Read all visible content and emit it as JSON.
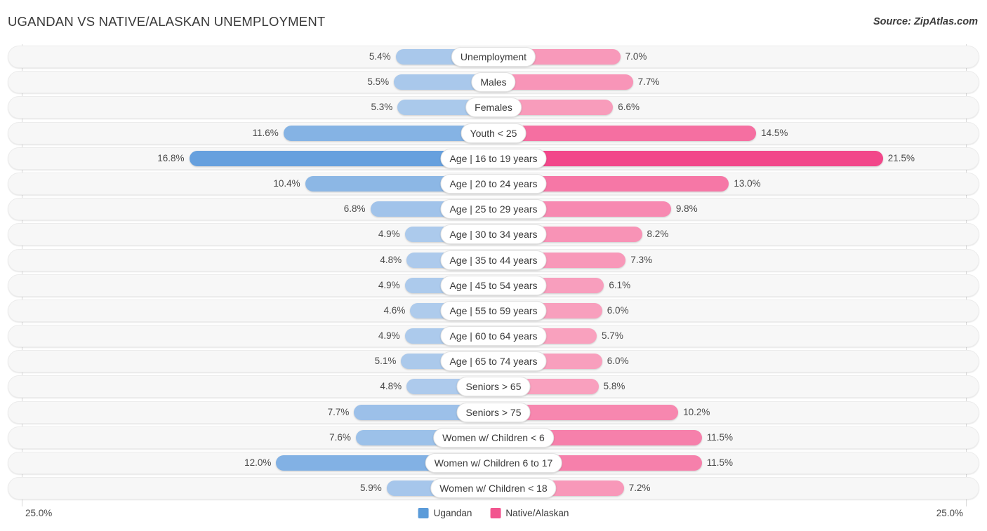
{
  "header": {
    "title": "UGANDAN VS NATIVE/ALASKAN UNEMPLOYMENT",
    "source": "Source: ZipAtlas.com"
  },
  "axis": {
    "min_label": "25.0%",
    "max_label": "25.0%",
    "max_value": 25.0
  },
  "legend": {
    "items": [
      {
        "label": "Ugandan",
        "color": "#5b9bd9"
      },
      {
        "label": "Native/Alaskan",
        "color": "#f2558f"
      }
    ]
  },
  "chart_data": {
    "type": "bar",
    "orientation": "horizontal-diverging",
    "title": "UGANDAN VS NATIVE/ALASKAN UNEMPLOYMENT",
    "xlabel": "",
    "ylabel": "",
    "xlim": [
      25.0,
      25.0
    ],
    "grid": false,
    "legend_position": "bottom-center",
    "categories": [
      "Unemployment",
      "Males",
      "Females",
      "Youth < 25",
      "Age | 16 to 19 years",
      "Age | 20 to 24 years",
      "Age | 25 to 29 years",
      "Age | 30 to 34 years",
      "Age | 35 to 44 years",
      "Age | 45 to 54 years",
      "Age | 55 to 59 years",
      "Age | 60 to 64 years",
      "Age | 65 to 74 years",
      "Seniors > 65",
      "Seniors > 75",
      "Women w/ Children < 6",
      "Women w/ Children 6 to 17",
      "Women w/ Children < 18"
    ],
    "series": [
      {
        "name": "Ugandan",
        "side": "left",
        "color": "#5b9bd9",
        "values": [
          5.4,
          5.5,
          5.3,
          11.6,
          16.8,
          10.4,
          6.8,
          4.9,
          4.8,
          4.9,
          4.6,
          4.9,
          5.1,
          4.8,
          7.7,
          7.6,
          12.0,
          5.9
        ],
        "labels": [
          "5.4%",
          "5.5%",
          "5.3%",
          "11.6%",
          "16.8%",
          "10.4%",
          "6.8%",
          "4.9%",
          "4.8%",
          "4.9%",
          "4.6%",
          "4.9%",
          "5.1%",
          "4.8%",
          "7.7%",
          "7.6%",
          "12.0%",
          "5.9%"
        ]
      },
      {
        "name": "Native/Alaskan",
        "side": "right",
        "color": "#f2558f",
        "values": [
          7.0,
          7.7,
          6.6,
          14.5,
          21.5,
          13.0,
          9.8,
          8.2,
          7.3,
          6.1,
          6.0,
          5.7,
          6.0,
          5.8,
          10.2,
          11.5,
          11.5,
          7.2
        ],
        "labels": [
          "7.0%",
          "7.7%",
          "6.6%",
          "14.5%",
          "21.5%",
          "13.0%",
          "9.8%",
          "8.2%",
          "7.3%",
          "6.1%",
          "6.0%",
          "5.7%",
          "6.0%",
          "5.8%",
          "10.2%",
          "11.5%",
          "11.5%",
          "7.2%"
        ]
      }
    ]
  },
  "rows": [
    {
      "label": "Unemployment",
      "left": "5.4%",
      "right": "7.0%"
    },
    {
      "label": "Males",
      "left": "5.5%",
      "right": "7.7%"
    },
    {
      "label": "Females",
      "left": "5.3%",
      "right": "6.6%"
    },
    {
      "label": "Youth < 25",
      "left": "11.6%",
      "right": "14.5%"
    },
    {
      "label": "Age | 16 to 19 years",
      "left": "16.8%",
      "right": "21.5%"
    },
    {
      "label": "Age | 20 to 24 years",
      "left": "10.4%",
      "right": "13.0%"
    },
    {
      "label": "Age | 25 to 29 years",
      "left": "6.8%",
      "right": "9.8%"
    },
    {
      "label": "Age | 30 to 34 years",
      "left": "4.9%",
      "right": "8.2%"
    },
    {
      "label": "Age | 35 to 44 years",
      "left": "4.8%",
      "right": "7.3%"
    },
    {
      "label": "Age | 45 to 54 years",
      "left": "4.9%",
      "right": "6.1%"
    },
    {
      "label": "Age | 55 to 59 years",
      "left": "4.6%",
      "right": "6.0%"
    },
    {
      "label": "Age | 60 to 64 years",
      "left": "4.9%",
      "right": "5.7%"
    },
    {
      "label": "Age | 65 to 74 years",
      "left": "5.1%",
      "right": "6.0%"
    },
    {
      "label": "Seniors > 65",
      "left": "4.8%",
      "right": "5.8%"
    },
    {
      "label": "Seniors > 75",
      "left": "7.7%",
      "right": "10.2%"
    },
    {
      "label": "Women w/ Children < 6",
      "left": "7.6%",
      "right": "11.5%"
    },
    {
      "label": "Women w/ Children 6 to 17",
      "left": "12.0%",
      "right": "11.5%"
    },
    {
      "label": "Women w/ Children < 18",
      "left": "5.9%",
      "right": "7.2%"
    }
  ]
}
